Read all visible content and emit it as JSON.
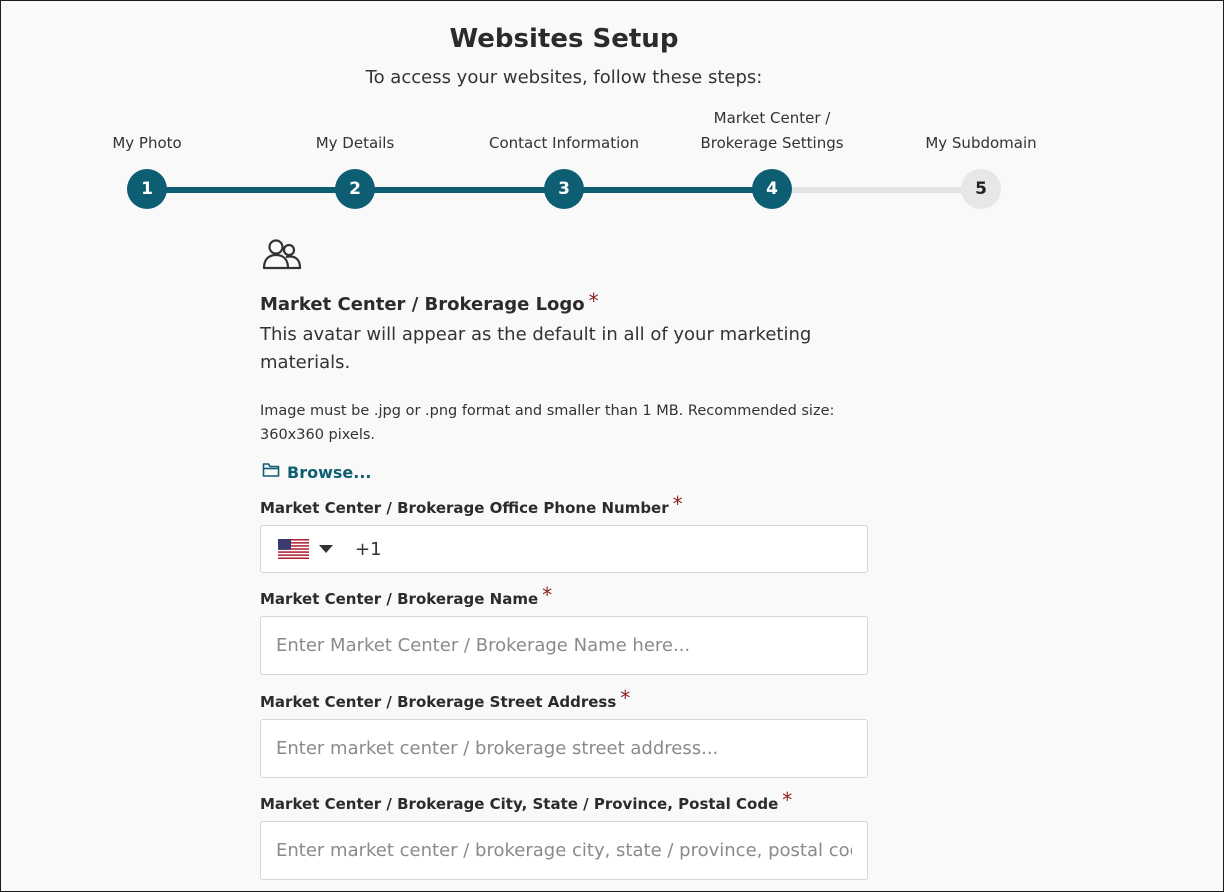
{
  "header": {
    "title": "Websites Setup",
    "subtitle": "To access your websites, follow these steps:"
  },
  "stepper": {
    "steps": [
      {
        "number": "1",
        "label": "My Photo",
        "status": "complete"
      },
      {
        "number": "2",
        "label": "My Details",
        "status": "complete"
      },
      {
        "number": "3",
        "label": "Contact Information",
        "status": "complete"
      },
      {
        "number": "4",
        "label_line1": "Market Center /",
        "label_line2": "Brokerage Settings",
        "status": "current"
      },
      {
        "number": "5",
        "label": "My Subdomain",
        "status": "upcoming"
      }
    ],
    "colors": {
      "complete": "#0e5e73",
      "upcoming": "#e7e7e7"
    }
  },
  "logo_section": {
    "icon": "users-icon",
    "title": "Market Center / Brokerage Logo",
    "required_mark": "*",
    "description": "This avatar will appear as the default in all of your marketing materials.",
    "hint": "Image must be .jpg or .png format and smaller than 1 MB. Recommended size: 360x360 pixels.",
    "browse_icon": "folder-icon",
    "browse_label": "Browse..."
  },
  "fields": {
    "phone": {
      "label": "Market Center / Brokerage Office Phone Number",
      "required_mark": "*",
      "country_flag": "us-flag-icon",
      "value": "+1"
    },
    "name": {
      "label": "Market Center / Brokerage Name",
      "required_mark": "*",
      "value": "",
      "placeholder": "Enter Market Center / Brokerage Name here..."
    },
    "street": {
      "label": "Market Center / Brokerage Street Address",
      "required_mark": "*",
      "value": "",
      "placeholder": "Enter market center / brokerage street address..."
    },
    "city": {
      "label": "Market Center / Brokerage City, State / Province, Postal Code",
      "required_mark": "*",
      "value": "",
      "placeholder": "Enter market center / brokerage city, state / province, postal code..."
    }
  }
}
